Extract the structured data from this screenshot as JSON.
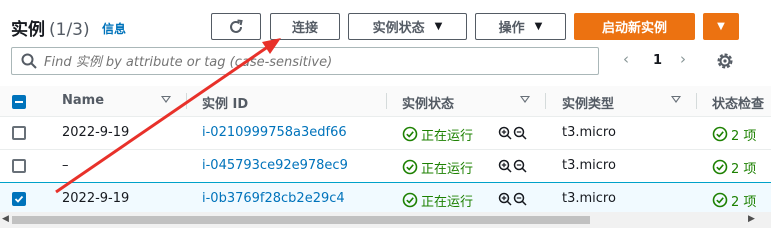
{
  "header": {
    "title": "实例",
    "count": "(1/3)",
    "info": "信息",
    "connect_label": "连接",
    "state_label": "实例状态",
    "actions_label": "操作",
    "launch_label": "启动新实例"
  },
  "search": {
    "placeholder": "Find 实例 by attribute or tag (case-sensitive)"
  },
  "pagination": {
    "page": "1"
  },
  "columns": {
    "name": "Name",
    "instance_id": "实例 ID",
    "instance_state": "实例状态",
    "instance_type": "实例类型",
    "status_check": "状态检查"
  },
  "rows": [
    {
      "name": "2022-9-19",
      "id": "i-0210999758a3edf66",
      "state": "正在运行",
      "type": "t3.micro",
      "check": "2 项",
      "selected": false
    },
    {
      "name": "–",
      "id": "i-045793ce92e978ec9",
      "state": "正在运行",
      "type": "t3.micro",
      "check": "2 项",
      "selected": false
    },
    {
      "name": "2022-9-19",
      "id": "i-0b3769f28cb2e29c4",
      "state": "正在运行",
      "type": "t3.micro",
      "check": "2 项",
      "selected": true
    }
  ],
  "colors": {
    "accent": "#ec7211",
    "link": "#0073bb",
    "success": "#1d8102",
    "annotation": "#e8312a"
  },
  "icons": [
    "refresh-icon",
    "caret-down-icon",
    "search-icon",
    "chevron-left-icon",
    "chevron-right-icon",
    "settings-gear-icon",
    "check-circle-icon",
    "zoom-in-icon",
    "zoom-out-icon",
    "sort-icon"
  ]
}
